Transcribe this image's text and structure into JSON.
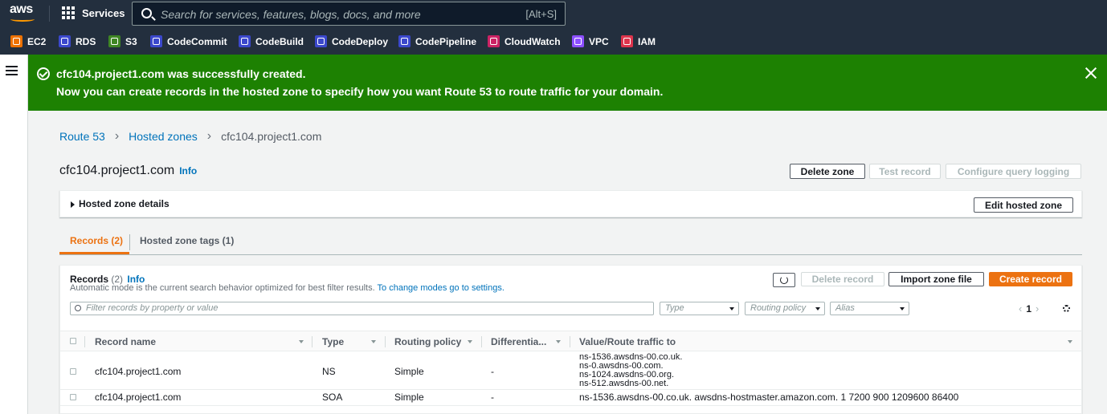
{
  "topnav": {
    "logo": "aws",
    "services_label": "Services",
    "search_placeholder": "Search for services, features, blogs, docs, and more",
    "search_shortcut": "[Alt+S]"
  },
  "favorites": [
    {
      "label": "EC2",
      "color": "#ed7100"
    },
    {
      "label": "RDS",
      "color": "#3b48cc"
    },
    {
      "label": "S3",
      "color": "#3f8624"
    },
    {
      "label": "CodeCommit",
      "color": "#3b48cc"
    },
    {
      "label": "CodeBuild",
      "color": "#3b48cc"
    },
    {
      "label": "CodeDeploy",
      "color": "#3b48cc"
    },
    {
      "label": "CodePipeline",
      "color": "#3b48cc"
    },
    {
      "label": "CloudWatch",
      "color": "#cc2264"
    },
    {
      "label": "VPC",
      "color": "#8c4fff"
    },
    {
      "label": "IAM",
      "color": "#dd344c"
    }
  ],
  "flash": {
    "title": "cfc104.project1.com was successfully created.",
    "message": "Now you can create records in the hosted zone to specify how you want Route 53 to route traffic for your domain.",
    "color": "#1d8102"
  },
  "breadcrumb": [
    "Route 53",
    "Hosted zones",
    "cfc104.project1.com"
  ],
  "page": {
    "title": "cfc104.project1.com",
    "info": "Info",
    "delete_zone": "Delete zone",
    "test_record": "Test record",
    "configure_logging": "Configure query logging"
  },
  "details": {
    "label": "Hosted zone details",
    "edit_button": "Edit hosted zone"
  },
  "tabs": [
    {
      "label": "Records (2)",
      "active": true
    },
    {
      "label": "Hosted zone tags (1)",
      "active": false
    }
  ],
  "records": {
    "title": "Records",
    "count": "(2)",
    "info": "Info",
    "description": "Automatic mode is the current search behavior optimized for best filter results.",
    "change_modes_link": "To change modes go to settings.",
    "delete_record": "Delete record",
    "import_zone_file": "Import zone file",
    "create_record": "Create record",
    "filter_placeholder": "Filter records by property or value",
    "type_placeholder": "Type",
    "routing_placeholder": "Routing policy",
    "alias_placeholder": "Alias",
    "page": "1",
    "columns": [
      "Record name",
      "Type",
      "Routing policy",
      "Differentia...",
      "Value/Route traffic to"
    ],
    "rows": [
      {
        "name": "cfc104.project1.com",
        "type": "NS",
        "routing": "Simple",
        "diff": "-",
        "values": [
          "ns-1536.awsdns-00.co.uk.",
          "ns-0.awsdns-00.com.",
          "ns-1024.awsdns-00.org.",
          "ns-512.awsdns-00.net."
        ]
      },
      {
        "name": "cfc104.project1.com",
        "type": "SOA",
        "routing": "Simple",
        "diff": "-",
        "values": [
          "ns-1536.awsdns-00.co.uk. awsdns-hostmaster.amazon.com. 1 7200 900 1209600 86400"
        ]
      }
    ]
  }
}
